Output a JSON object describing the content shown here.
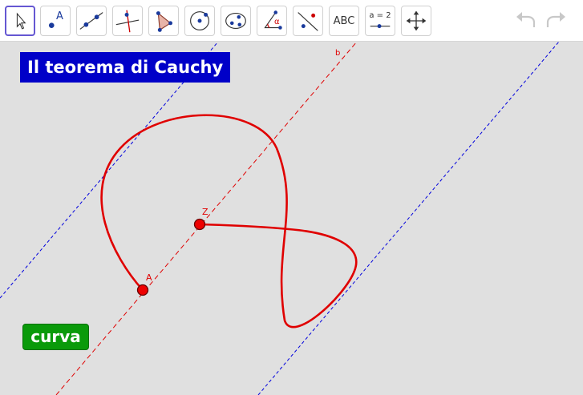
{
  "toolbar": {
    "tools": [
      {
        "name": "move",
        "icon": "cursor-arrow-icon"
      },
      {
        "name": "point",
        "icon": "point-icon",
        "label": "A"
      },
      {
        "name": "line",
        "icon": "line-icon"
      },
      {
        "name": "perpendicular",
        "icon": "perpendicular-line-icon"
      },
      {
        "name": "polygon",
        "icon": "polygon-icon"
      },
      {
        "name": "circle",
        "icon": "circle-center-point-icon"
      },
      {
        "name": "conic",
        "icon": "conic-ellipse-icon"
      },
      {
        "name": "angle",
        "icon": "angle-icon",
        "label": "α"
      },
      {
        "name": "reflect",
        "icon": "reflect-line-icon"
      },
      {
        "name": "text",
        "icon": "text-icon",
        "label": "ABC"
      },
      {
        "name": "slider",
        "icon": "slider-icon",
        "label": "a = 2"
      },
      {
        "name": "move-graphics",
        "icon": "move-graphics-icon"
      }
    ],
    "undo_icon": "undo-icon",
    "redo_icon": "redo-icon"
  },
  "title": "Il teorema di Cauchy",
  "button_label": "curva",
  "labels": {
    "line_b": "b",
    "point_z": "Z",
    "point_a": "A"
  },
  "colors": {
    "title_bg": "#0000c8",
    "button_bg": "#0a9a0a",
    "curve": "#e00000",
    "tangent": "#0000dd",
    "canvas_bg": "#e0e0e0"
  }
}
